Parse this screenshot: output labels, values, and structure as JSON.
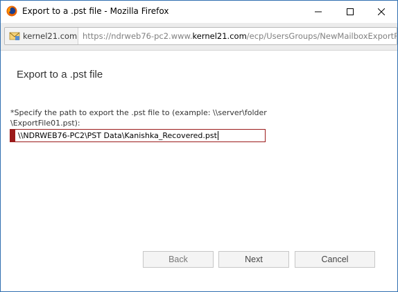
{
  "window": {
    "title": "Export to a .pst file - Mozilla Firefox",
    "controls": {
      "minimize": "minimize",
      "maximize": "maximize",
      "close": "close"
    }
  },
  "urlbar": {
    "site_name": "kernel21.com",
    "url_prefix": "https://ndrweb76-pc2.www.",
    "url_domain": "kernel21.com",
    "url_suffix": "/ecp/UsersGroups/NewMailboxExportR"
  },
  "dialog": {
    "title": "Export to a .pst file",
    "path_label": "*Specify the path to export the .pst file to (example: \\\\server\\folder \\ExportFile01.pst):",
    "path_value": "\\\\NDRWEB76-PC2\\PST Data\\Kanishka_Recovered.pst"
  },
  "buttons": {
    "back": "Back",
    "next": "Next",
    "cancel": "Cancel"
  },
  "colors": {
    "required": "#9b1b1b",
    "window_border": "#2f6fb0"
  },
  "icons": {
    "app": "firefox-icon",
    "site": "mail-site-icon"
  }
}
